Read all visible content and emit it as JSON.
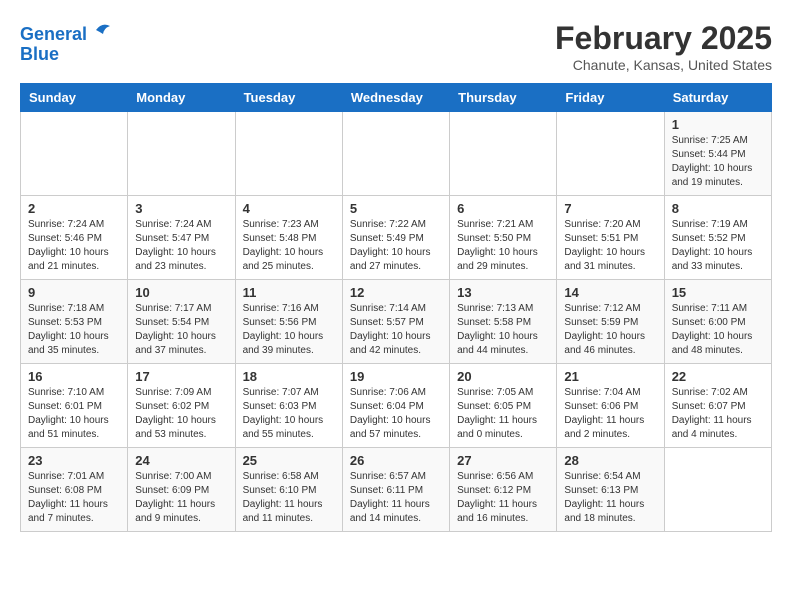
{
  "header": {
    "logo_line1": "General",
    "logo_line2": "Blue",
    "month_title": "February 2025",
    "location": "Chanute, Kansas, United States"
  },
  "days_of_week": [
    "Sunday",
    "Monday",
    "Tuesday",
    "Wednesday",
    "Thursday",
    "Friday",
    "Saturday"
  ],
  "weeks": [
    [
      {
        "day": "",
        "info": ""
      },
      {
        "day": "",
        "info": ""
      },
      {
        "day": "",
        "info": ""
      },
      {
        "day": "",
        "info": ""
      },
      {
        "day": "",
        "info": ""
      },
      {
        "day": "",
        "info": ""
      },
      {
        "day": "1",
        "info": "Sunrise: 7:25 AM\nSunset: 5:44 PM\nDaylight: 10 hours and 19 minutes."
      }
    ],
    [
      {
        "day": "2",
        "info": "Sunrise: 7:24 AM\nSunset: 5:46 PM\nDaylight: 10 hours and 21 minutes."
      },
      {
        "day": "3",
        "info": "Sunrise: 7:24 AM\nSunset: 5:47 PM\nDaylight: 10 hours and 23 minutes."
      },
      {
        "day": "4",
        "info": "Sunrise: 7:23 AM\nSunset: 5:48 PM\nDaylight: 10 hours and 25 minutes."
      },
      {
        "day": "5",
        "info": "Sunrise: 7:22 AM\nSunset: 5:49 PM\nDaylight: 10 hours and 27 minutes."
      },
      {
        "day": "6",
        "info": "Sunrise: 7:21 AM\nSunset: 5:50 PM\nDaylight: 10 hours and 29 minutes."
      },
      {
        "day": "7",
        "info": "Sunrise: 7:20 AM\nSunset: 5:51 PM\nDaylight: 10 hours and 31 minutes."
      },
      {
        "day": "8",
        "info": "Sunrise: 7:19 AM\nSunset: 5:52 PM\nDaylight: 10 hours and 33 minutes."
      }
    ],
    [
      {
        "day": "9",
        "info": "Sunrise: 7:18 AM\nSunset: 5:53 PM\nDaylight: 10 hours and 35 minutes."
      },
      {
        "day": "10",
        "info": "Sunrise: 7:17 AM\nSunset: 5:54 PM\nDaylight: 10 hours and 37 minutes."
      },
      {
        "day": "11",
        "info": "Sunrise: 7:16 AM\nSunset: 5:56 PM\nDaylight: 10 hours and 39 minutes."
      },
      {
        "day": "12",
        "info": "Sunrise: 7:14 AM\nSunset: 5:57 PM\nDaylight: 10 hours and 42 minutes."
      },
      {
        "day": "13",
        "info": "Sunrise: 7:13 AM\nSunset: 5:58 PM\nDaylight: 10 hours and 44 minutes."
      },
      {
        "day": "14",
        "info": "Sunrise: 7:12 AM\nSunset: 5:59 PM\nDaylight: 10 hours and 46 minutes."
      },
      {
        "day": "15",
        "info": "Sunrise: 7:11 AM\nSunset: 6:00 PM\nDaylight: 10 hours and 48 minutes."
      }
    ],
    [
      {
        "day": "16",
        "info": "Sunrise: 7:10 AM\nSunset: 6:01 PM\nDaylight: 10 hours and 51 minutes."
      },
      {
        "day": "17",
        "info": "Sunrise: 7:09 AM\nSunset: 6:02 PM\nDaylight: 10 hours and 53 minutes."
      },
      {
        "day": "18",
        "info": "Sunrise: 7:07 AM\nSunset: 6:03 PM\nDaylight: 10 hours and 55 minutes."
      },
      {
        "day": "19",
        "info": "Sunrise: 7:06 AM\nSunset: 6:04 PM\nDaylight: 10 hours and 57 minutes."
      },
      {
        "day": "20",
        "info": "Sunrise: 7:05 AM\nSunset: 6:05 PM\nDaylight: 11 hours and 0 minutes."
      },
      {
        "day": "21",
        "info": "Sunrise: 7:04 AM\nSunset: 6:06 PM\nDaylight: 11 hours and 2 minutes."
      },
      {
        "day": "22",
        "info": "Sunrise: 7:02 AM\nSunset: 6:07 PM\nDaylight: 11 hours and 4 minutes."
      }
    ],
    [
      {
        "day": "23",
        "info": "Sunrise: 7:01 AM\nSunset: 6:08 PM\nDaylight: 11 hours and 7 minutes."
      },
      {
        "day": "24",
        "info": "Sunrise: 7:00 AM\nSunset: 6:09 PM\nDaylight: 11 hours and 9 minutes."
      },
      {
        "day": "25",
        "info": "Sunrise: 6:58 AM\nSunset: 6:10 PM\nDaylight: 11 hours and 11 minutes."
      },
      {
        "day": "26",
        "info": "Sunrise: 6:57 AM\nSunset: 6:11 PM\nDaylight: 11 hours and 14 minutes."
      },
      {
        "day": "27",
        "info": "Sunrise: 6:56 AM\nSunset: 6:12 PM\nDaylight: 11 hours and 16 minutes."
      },
      {
        "day": "28",
        "info": "Sunrise: 6:54 AM\nSunset: 6:13 PM\nDaylight: 11 hours and 18 minutes."
      },
      {
        "day": "",
        "info": ""
      }
    ]
  ]
}
